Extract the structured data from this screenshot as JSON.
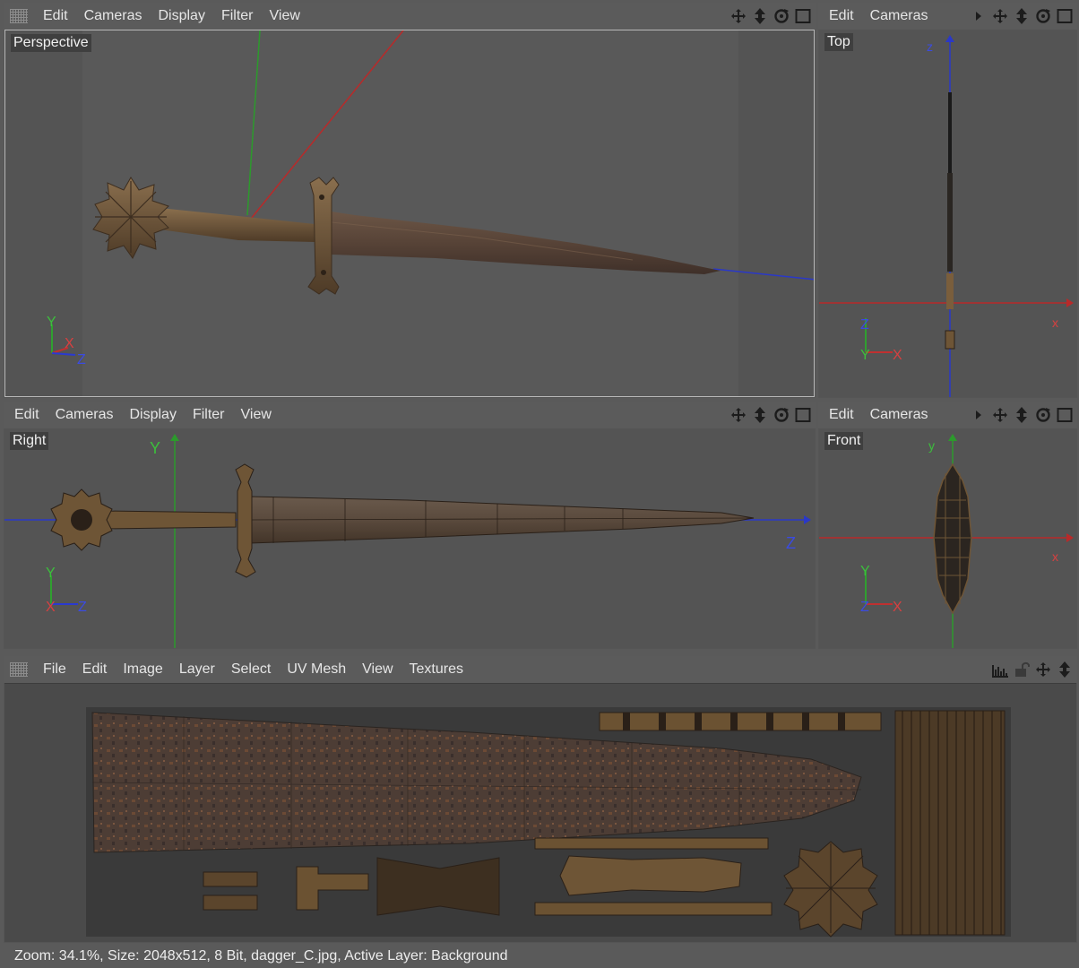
{
  "perspective_pane": {
    "menu": [
      "Edit",
      "Cameras",
      "Display",
      "Filter",
      "View"
    ],
    "label": "Perspective",
    "tools": [
      "move-icon",
      "zoom-icon",
      "rotate-icon",
      "maximize-icon"
    ],
    "axes": {
      "y": "Y",
      "x": "X",
      "z": "Z"
    }
  },
  "top_pane": {
    "menu": [
      "Edit",
      "Cameras"
    ],
    "label": "Top",
    "tools": [
      "play-arrow-icon",
      "move-icon",
      "zoom-icon",
      "rotate-icon",
      "maximize-icon"
    ],
    "axes": {
      "z": "Z",
      "y": "Y",
      "x": "X"
    },
    "grid_labels": {
      "z": "z",
      "x": "x"
    }
  },
  "right_pane": {
    "menu": [
      "Edit",
      "Cameras",
      "Display",
      "Filter",
      "View"
    ],
    "label": "Right",
    "tools": [
      "move-icon",
      "zoom-icon",
      "rotate-icon",
      "maximize-icon"
    ],
    "axes": {
      "y": "Y",
      "x": "X",
      "z": "Z"
    },
    "grid_labels": {
      "y": "Y",
      "z": "Z"
    }
  },
  "front_pane": {
    "menu": [
      "Edit",
      "Cameras"
    ],
    "label": "Front",
    "tools": [
      "play-arrow-icon",
      "move-icon",
      "zoom-icon",
      "rotate-icon",
      "maximize-icon"
    ],
    "axes": {
      "y": "Y",
      "z": "Z",
      "x": "X"
    },
    "grid_labels": {
      "y": "y",
      "x": "x"
    }
  },
  "texture_pane": {
    "menu": [
      "File",
      "Edit",
      "Image",
      "Layer",
      "Select",
      "UV Mesh",
      "View",
      "Textures"
    ],
    "tools": [
      "histogram-icon",
      "lock-icon",
      "move-icon",
      "zoom-icon"
    ]
  },
  "status": {
    "text": "Zoom: 34.1%, Size: 2048x512, 8 Bit, dagger_C.jpg, Active Layer: Background"
  },
  "colors": {
    "panel": "#5b5b5b",
    "viewport": "#545454",
    "axis_x": "#c03030",
    "axis_y": "#30a030",
    "axis_z": "#2a3ad0",
    "rust": "#5b4538",
    "bronze": "#6e5536"
  }
}
